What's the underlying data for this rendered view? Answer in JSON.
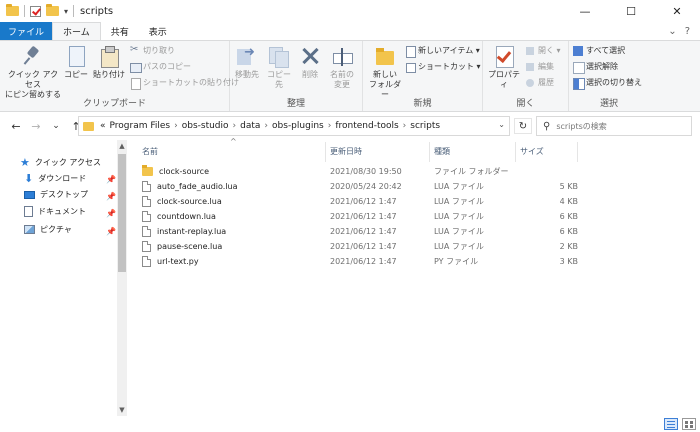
{
  "window": {
    "title": "scripts",
    "minimize": "—",
    "maximize": "☐",
    "close": "✕"
  },
  "quick_access_toolbar": {
    "dropdown": "▾"
  },
  "ribbon_tabs": {
    "file": "ファイル",
    "home": "ホーム",
    "share": "共有",
    "view": "表示",
    "collapse": "⌄",
    "help": "?"
  },
  "ribbon": {
    "clipboard": {
      "label": "クリップボード",
      "pin_quick_access": "クイック アクセス\nにピン留めする",
      "copy": "コピー",
      "paste": "貼り付け",
      "cut": "切り取り",
      "copy_path": "パスのコピー",
      "paste_shortcut": "ショートカットの貼り付け"
    },
    "organize": {
      "label": "整理",
      "move_to": "移動先",
      "copy_to": "コピー先",
      "delete": "削除",
      "rename": "名前の\n変更"
    },
    "new": {
      "label": "新規",
      "new_folder": "新しい\nフォルダー",
      "new_item": "新しいアイテム ▾",
      "easy_access": "ショートカット ▾"
    },
    "open": {
      "label": "開く",
      "properties": "プロパティ",
      "open": "開く ▾",
      "edit": "編集",
      "history": "履歴"
    },
    "select": {
      "label": "選択",
      "select_all": "すべて選択",
      "select_none": "選択解除",
      "invert": "選択の切り替え"
    }
  },
  "navigation": {
    "back": "←",
    "forward": "→",
    "recent": "⌄",
    "up": "↑",
    "overflow": "«",
    "breadcrumb": [
      "Program Files",
      "obs-studio",
      "data",
      "obs-plugins",
      "frontend-tools",
      "scripts"
    ],
    "separator": "›",
    "address_dropdown": "⌄",
    "refresh": "↻",
    "search_placeholder": "scriptsの検索"
  },
  "sidebar": {
    "items": [
      {
        "label": "クイック アクセス",
        "icon": "star-icon"
      },
      {
        "label": "ダウンロード",
        "icon": "download-icon",
        "pinned": true
      },
      {
        "label": "デスクトップ",
        "icon": "desktop-icon",
        "pinned": true
      },
      {
        "label": "ドキュメント",
        "icon": "documents-icon",
        "pinned": true
      },
      {
        "label": "ピクチャ",
        "icon": "pictures-icon",
        "pinned": true
      }
    ],
    "pin_glyph": "📌",
    "scroll_up": "▲",
    "scroll_down": "▼"
  },
  "file_list": {
    "columns": {
      "name": "名前",
      "date": "更新日時",
      "type": "種類",
      "size": "サイズ"
    },
    "sort_indicator": "^",
    "rows": [
      {
        "name": "clock-source",
        "date": "2021/08/30 19:50",
        "type": "ファイル フォルダー",
        "size": "",
        "kind": "folder"
      },
      {
        "name": "auto_fade_audio.lua",
        "date": "2020/05/24 20:42",
        "type": "LUA ファイル",
        "size": "5 KB",
        "kind": "file"
      },
      {
        "name": "clock-source.lua",
        "date": "2021/06/12 1:47",
        "type": "LUA ファイル",
        "size": "4 KB",
        "kind": "file"
      },
      {
        "name": "countdown.lua",
        "date": "2021/06/12 1:47",
        "type": "LUA ファイル",
        "size": "6 KB",
        "kind": "file"
      },
      {
        "name": "instant-replay.lua",
        "date": "2021/06/12 1:47",
        "type": "LUA ファイル",
        "size": "6 KB",
        "kind": "file"
      },
      {
        "name": "pause-scene.lua",
        "date": "2021/06/12 1:47",
        "type": "LUA ファイル",
        "size": "2 KB",
        "kind": "file"
      },
      {
        "name": "url-text.py",
        "date": "2021/06/12 1:47",
        "type": "PY ファイル",
        "size": "3 KB",
        "kind": "file"
      }
    ]
  },
  "colors": {
    "file_tab": "#1979ca",
    "accent": "#2d7ed6",
    "folder": "#f2c44c"
  }
}
